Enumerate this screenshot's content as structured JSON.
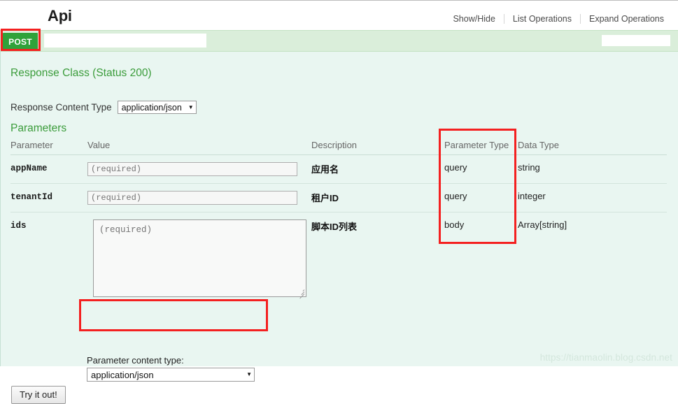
{
  "header": {
    "resource_title": "Api",
    "options": [
      {
        "label": "Show/Hide"
      },
      {
        "label": "List Operations"
      },
      {
        "label": "Expand Operations"
      }
    ]
  },
  "operation": {
    "method": "POST",
    "path_redacted": "",
    "right_redacted": ""
  },
  "response": {
    "class_title": "Response Class (Status 200)",
    "content_type_label": "Response Content Type",
    "content_type_value": "application/json"
  },
  "parameters": {
    "title": "Parameters",
    "columns": {
      "parameter": "Parameter",
      "value": "Value",
      "description": "Description",
      "parameter_type": "Parameter Type",
      "data_type": "Data Type"
    },
    "rows": [
      {
        "name": "appName",
        "value_placeholder": "(required)",
        "description": "应用名",
        "parameter_type": "query",
        "data_type": "string",
        "input_kind": "text"
      },
      {
        "name": "tenantId",
        "value_placeholder": "(required)",
        "description": "租户ID",
        "parameter_type": "query",
        "data_type": "integer",
        "input_kind": "text"
      },
      {
        "name": "ids",
        "value_placeholder": "(required)",
        "description": "脚本ID列表",
        "parameter_type": "body",
        "data_type": "Array[string]",
        "input_kind": "textarea"
      }
    ]
  },
  "content_type": {
    "label": "Parameter content type:",
    "value": "application/json"
  },
  "actions": {
    "try_it_out": "Try it out!"
  },
  "watermark": {
    "text": "https://tianmaolin.blog.csdn.net"
  },
  "colors": {
    "method_post": "#30a23a",
    "annotation": "#f42020",
    "section_title": "#3b9c3b",
    "op_bar": "#daeeda",
    "op_body": "#e9f6f1"
  }
}
